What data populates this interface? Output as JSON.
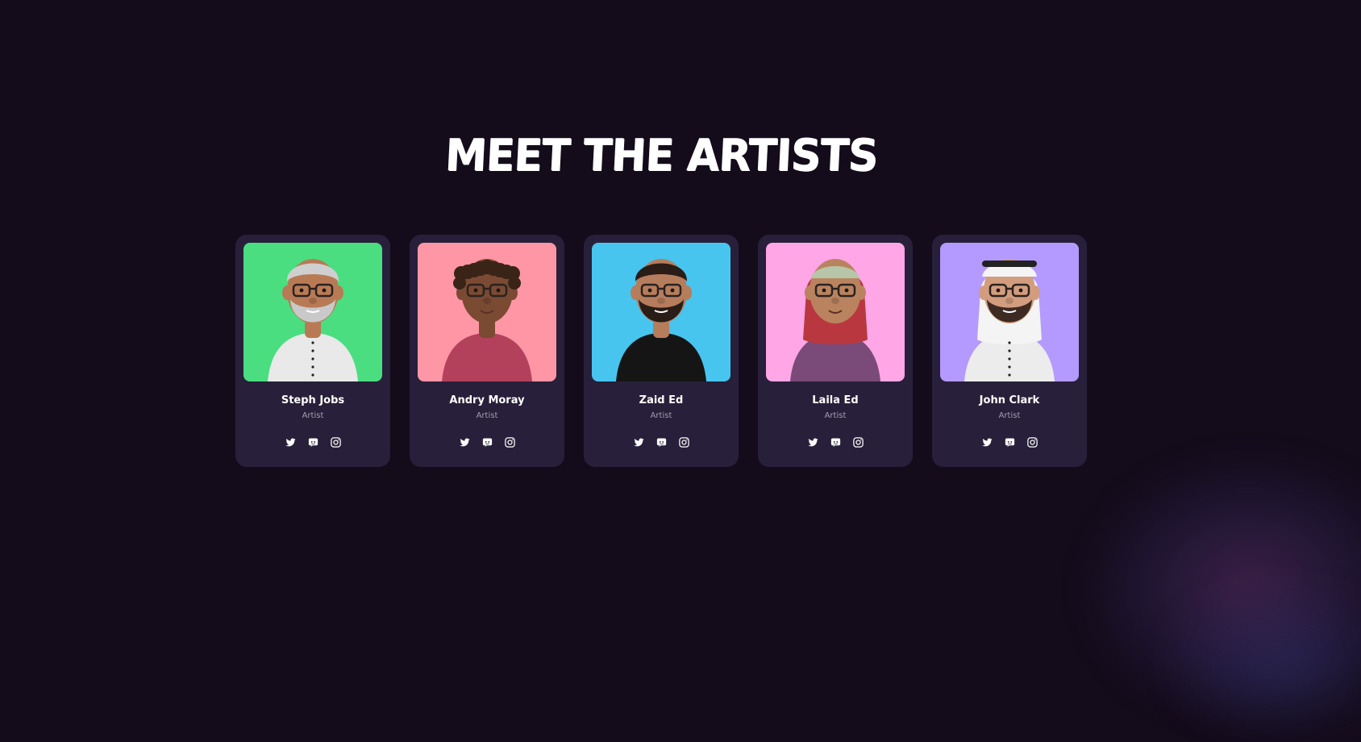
{
  "page": {
    "title": "MEET THE ARTISTS"
  },
  "artists": [
    {
      "name": "Steph Jobs",
      "role": "Artist",
      "bg": "#4ade80",
      "skin": "#b87a55",
      "hair": "#cfcfcf",
      "shirt": "#e9e9e9",
      "beard": "#c9c9c9",
      "headwear": "none"
    },
    {
      "name": "Andry Moray",
      "role": "Artist",
      "bg": "#ff96a6",
      "skin": "#7a4a33",
      "hair": "#3a2418",
      "shirt": "#b4415c",
      "beard": "none",
      "headwear": "curls"
    },
    {
      "name": "Zaid Ed",
      "role": "Artist",
      "bg": "#47c5ee",
      "skin": "#b67d5c",
      "hair": "#2a1d18",
      "shirt": "#151515",
      "beard": "#2a1d18",
      "headwear": "none"
    },
    {
      "name": "Laila Ed",
      "role": "Artist",
      "bg": "#ffa6e6",
      "skin": "#b9835f",
      "hair": "#b9383f",
      "shirt": "#7a4a78",
      "beard": "none",
      "headwear": "hijab"
    },
    {
      "name": "John Clark",
      "role": "Artist",
      "bg": "#b49aff",
      "skin": "#d29d7e",
      "hair": "#3d2a22",
      "shirt": "#ececec",
      "beard": "#3d2a22",
      "headwear": "keffiyeh"
    }
  ],
  "social_icons": [
    "twitter-icon",
    "discord-icon",
    "instagram-icon"
  ]
}
